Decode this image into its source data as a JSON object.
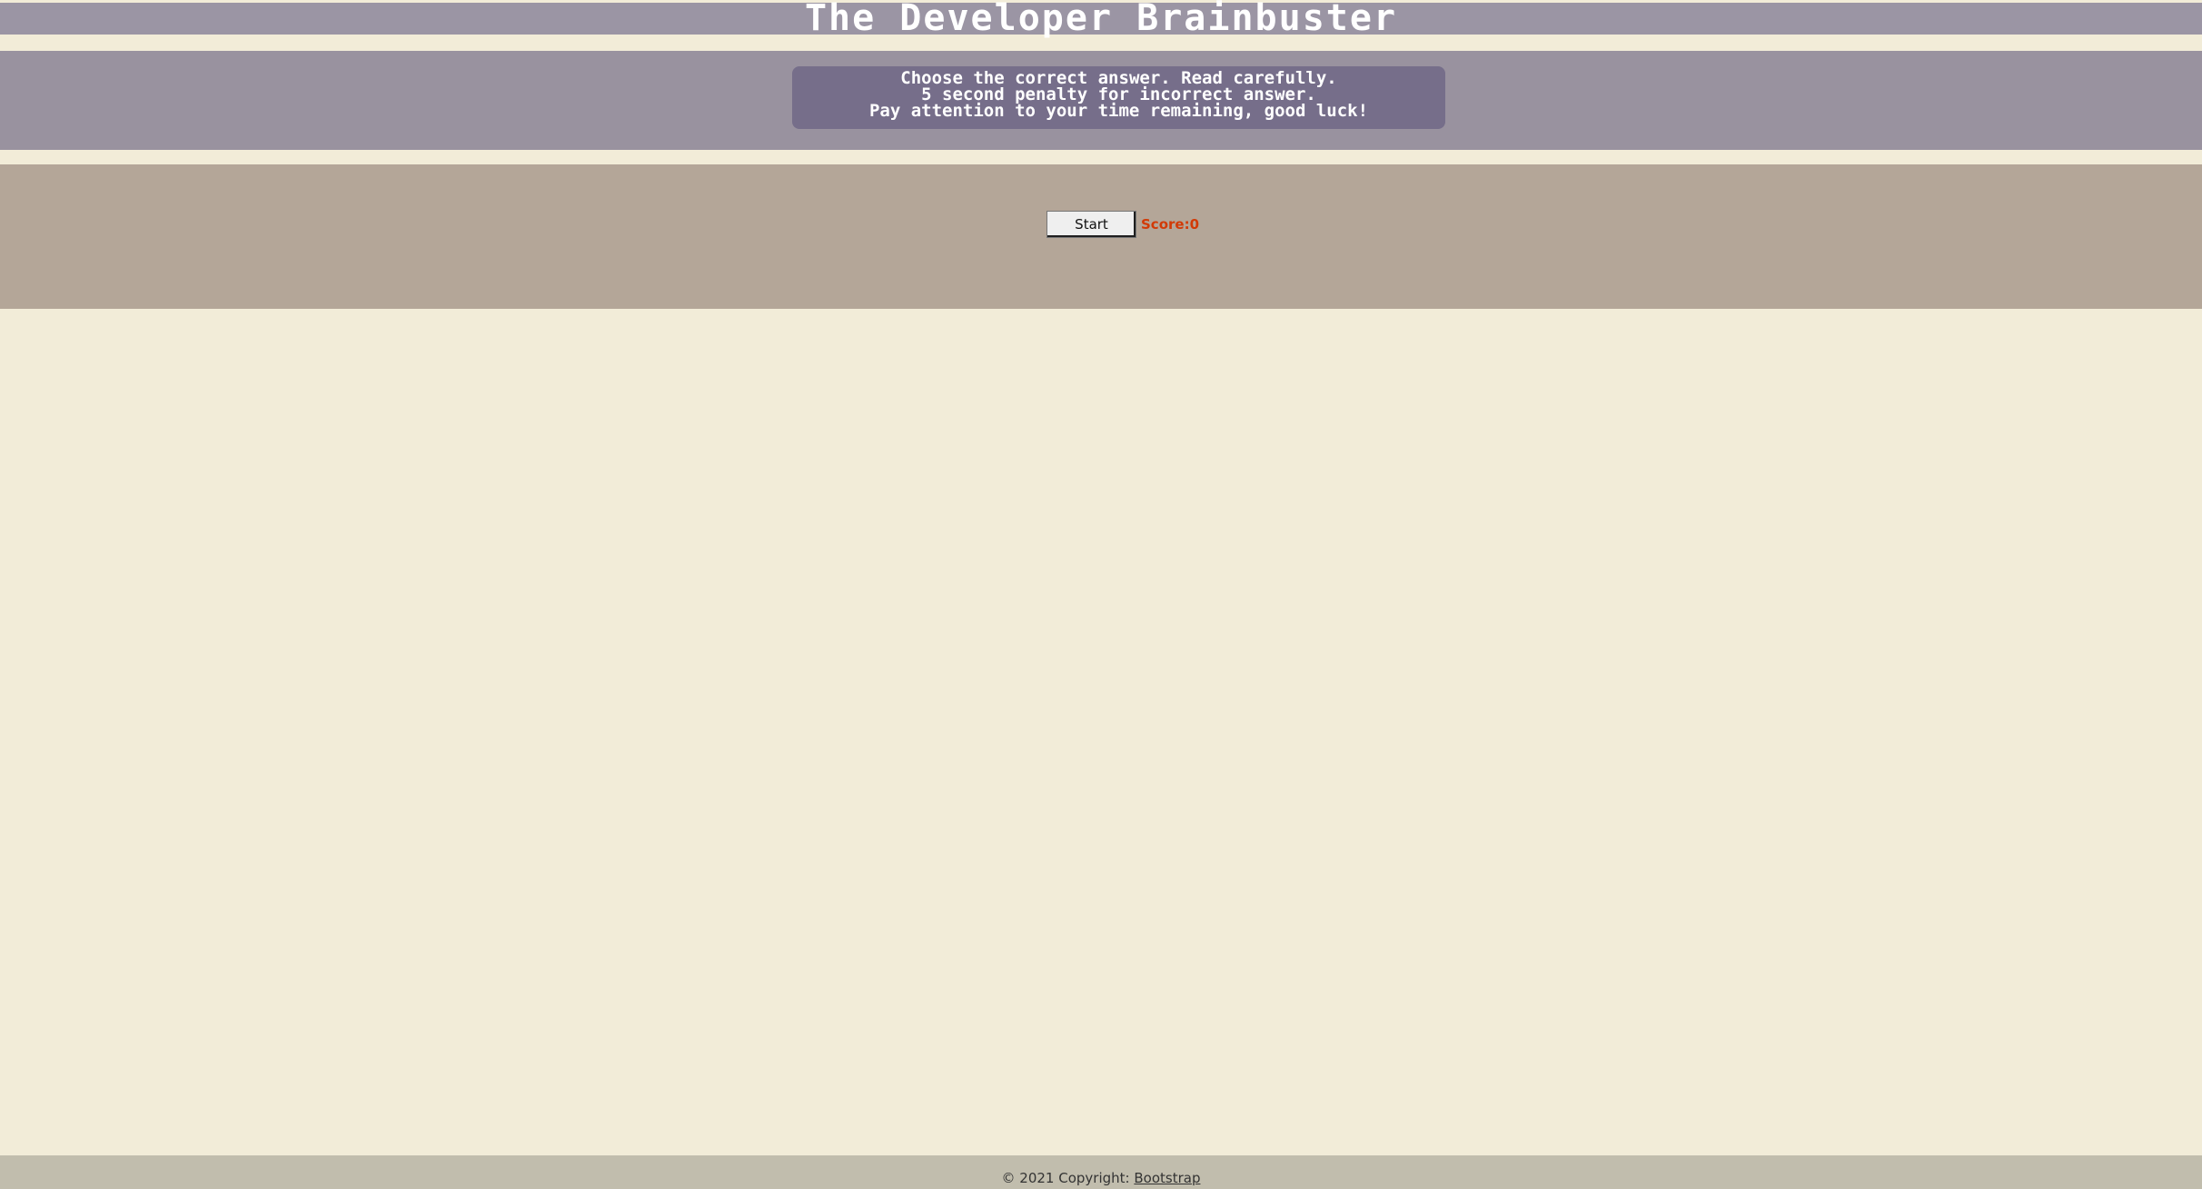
{
  "header": {
    "title": "The Developer Brainbuster"
  },
  "instructions": {
    "line1": "Choose the correct answer. Read carefully.",
    "line2": "5 second penalty for incorrect answer.",
    "line3": "Pay attention to your time remaining, good luck!"
  },
  "quiz": {
    "start_label": "Start",
    "score_label": "Score:",
    "score_value": "0"
  },
  "footer": {
    "copyright_text": "© 2021 Copyright: ",
    "link_text": "Bootstrap"
  },
  "colors": {
    "page_background": "#f2ecd8",
    "title_bar": "#9b95a4",
    "instructions_band": "#99929f",
    "instructions_box": "#766e8a",
    "quiz_band": "#b4a698",
    "score_text": "#d23a06",
    "footer_background": "#c1bdad"
  }
}
